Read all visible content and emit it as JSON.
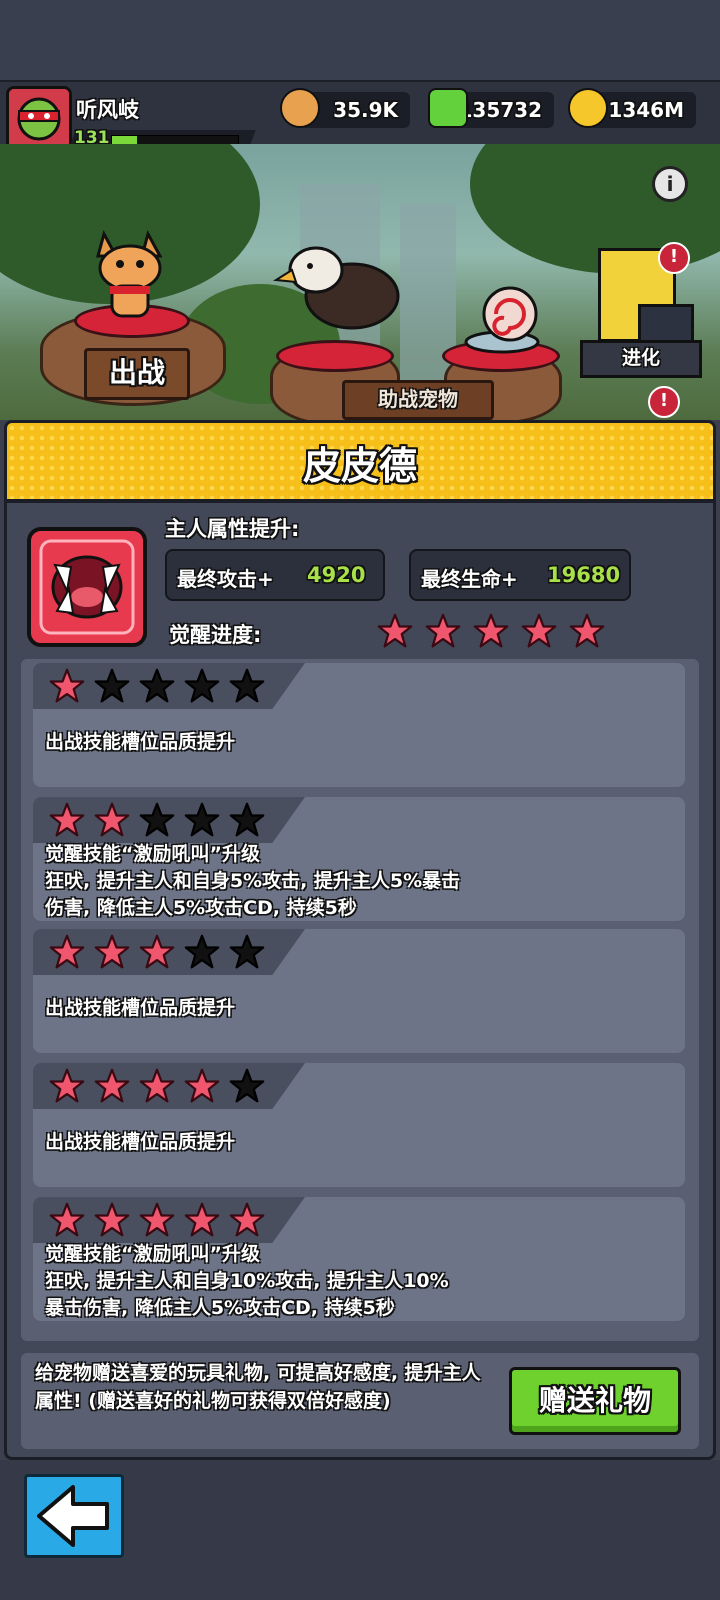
{
  "player": {
    "name": "听风岐",
    "level": "131",
    "xp_fraction": 0.2
  },
  "currencies": [
    {
      "icon": "coin-bag-icon",
      "value": "35.9K"
    },
    {
      "icon": "green-gem-icon",
      "value": "135732"
    },
    {
      "icon": "gold-coin-icon",
      "value": "1346M"
    }
  ],
  "scene": {
    "deploy_label": "出战",
    "assist_label": "助战宠物",
    "evolve_label": "进化",
    "info_glyph": "i",
    "alert_glyph": "!"
  },
  "pet": {
    "name": "皮皮德"
  },
  "attributes": {
    "title": "主人属性提升:",
    "attack_label": "最终攻击+",
    "attack_value": "4920",
    "hp_label": "最终生命+",
    "hp_value": "19680",
    "awaken_label": "觉醒进度:",
    "awaken_stars_filled": 5,
    "awaken_stars_total": 5
  },
  "levels": [
    {
      "stars": 1,
      "text": "出战技能槽位品质提升"
    },
    {
      "stars": 2,
      "text": "觉醒技能“激励吼叫”升级\n狂吠, 提升主人和自身5%攻击, 提升主人5%暴击\n伤害, 降低主人5%攻击CD, 持续5秒"
    },
    {
      "stars": 3,
      "text": "出战技能槽位品质提升"
    },
    {
      "stars": 4,
      "text": "出战技能槽位品质提升"
    },
    {
      "stars": 5,
      "text": "觉醒技能“激励吼叫”升级\n狂吠, 提升主人和自身10%攻击, 提升主人10%\n暴击伤害, 降低主人5%攻击CD, 持续5秒"
    }
  ],
  "gift": {
    "text": "给宠物赠送喜爱的玩具礼物, 可提高好感度, 提升主人属性! (赠送喜好的礼物可获得双倍好感度)",
    "button_label": "赠送礼物"
  },
  "colors": {
    "star_filled": "#f0566e",
    "star_empty": "#111111",
    "accent_yellow": "#f6bf1a",
    "button_green": "#6fd12e"
  }
}
